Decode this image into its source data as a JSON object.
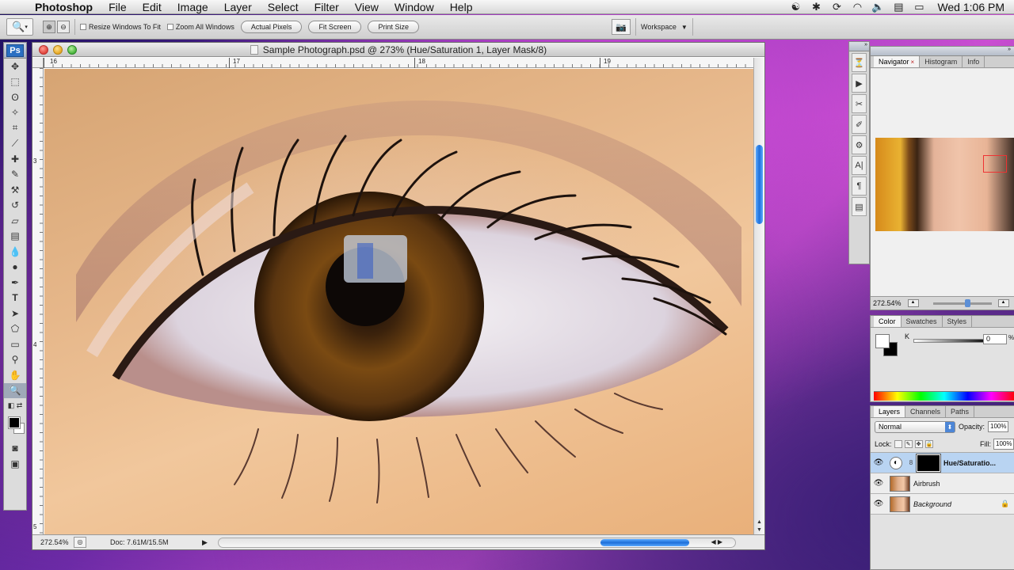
{
  "menubar": {
    "app_name": "Photoshop",
    "items": [
      "File",
      "Edit",
      "Image",
      "Layer",
      "Select",
      "Filter",
      "View",
      "Window",
      "Help"
    ],
    "clock": "Wed 1:06 PM"
  },
  "options": {
    "resize_windows": "Resize Windows To Fit",
    "zoom_all_windows": "Zoom All Windows",
    "actual_pixels": "Actual Pixels",
    "fit_screen": "Fit Screen",
    "print_size": "Print Size",
    "workspace": "Workspace"
  },
  "tools": {
    "logo": "Ps"
  },
  "document": {
    "title": "Sample Photograph.psd @ 273% (Hue/Saturation 1, Layer Mask/8)",
    "ruler_h": [
      "16",
      "17",
      "18",
      "19"
    ],
    "ruler_v": [
      "3",
      "4",
      "5"
    ],
    "status_zoom": "272.54%",
    "doc_size": "Doc: 7.61M/15.5M"
  },
  "navigator": {
    "tabs": [
      "Navigator",
      "Histogram",
      "Info"
    ],
    "zoom": "272.54%"
  },
  "color": {
    "tabs": [
      "Color",
      "Swatches",
      "Styles"
    ],
    "channel_label": "K",
    "value": "0",
    "unit": "%"
  },
  "layers": {
    "tabs": [
      "Layers",
      "Channels",
      "Paths"
    ],
    "blend_mode": "Normal",
    "opacity_label": "Opacity:",
    "opacity": "100%",
    "lock_label": "Lock:",
    "fill_label": "Fill:",
    "fill": "100%",
    "items": [
      {
        "name": "Hue/Saturatio..."
      },
      {
        "name": "Airbrush"
      },
      {
        "name": "Background"
      }
    ]
  },
  "colors": {
    "accent": "#1e6fd9",
    "selected_layer": "#b9d4f2",
    "close_red": "#e0443a"
  }
}
